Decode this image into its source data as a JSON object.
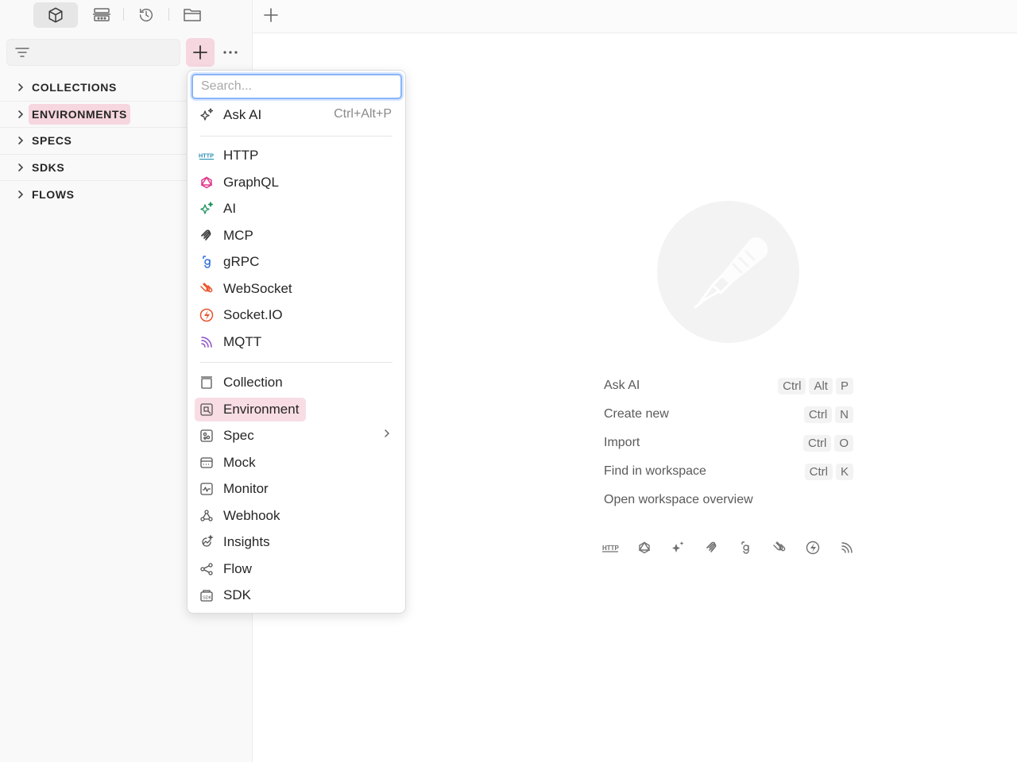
{
  "sidebar": {
    "icon_tabs": [
      "collections-cube-icon",
      "environments-icon",
      "history-icon",
      "folder-icon"
    ],
    "filter_icon": "filter-icon",
    "tree": [
      {
        "label": "COLLECTIONS",
        "highlighted": false
      },
      {
        "label": "ENVIRONMENTS",
        "highlighted": true
      },
      {
        "label": "SPECS",
        "highlighted": false
      },
      {
        "label": "SDKS",
        "highlighted": false
      },
      {
        "label": "FLOWS",
        "highlighted": false
      }
    ]
  },
  "menu": {
    "search_placeholder": "Search...",
    "ask_ai": {
      "label": "Ask AI",
      "shortcut": "Ctrl+Alt+P"
    },
    "protocols": [
      {
        "label": "HTTP",
        "icon": "http-icon",
        "color": "#2a8fb5"
      },
      {
        "label": "GraphQL",
        "icon": "graphql-icon",
        "color": "#e0378a"
      },
      {
        "label": "AI",
        "icon": "ai-sparkle-icon",
        "color": "#1f9361"
      },
      {
        "label": "MCP",
        "icon": "mcp-icon",
        "color": "#3a3a3a"
      },
      {
        "label": "gRPC",
        "icon": "grpc-icon",
        "color": "#2f6fd6"
      },
      {
        "label": "WebSocket",
        "icon": "websocket-icon",
        "color": "#e8532c"
      },
      {
        "label": "Socket.IO",
        "icon": "socketio-icon",
        "color": "#e8532c"
      },
      {
        "label": "MQTT",
        "icon": "mqtt-icon",
        "color": "#8b4fc8"
      }
    ],
    "elements": [
      {
        "label": "Collection",
        "icon": "collection-icon"
      },
      {
        "label": "Environment",
        "icon": "environment-icon",
        "highlighted": true
      },
      {
        "label": "Spec",
        "icon": "spec-icon",
        "has_submenu": true
      },
      {
        "label": "Mock",
        "icon": "mock-icon"
      },
      {
        "label": "Monitor",
        "icon": "monitor-icon"
      },
      {
        "label": "Webhook",
        "icon": "webhook-icon"
      },
      {
        "label": "Insights",
        "icon": "insights-icon"
      },
      {
        "label": "Flow",
        "icon": "flow-icon"
      },
      {
        "label": "SDK",
        "icon": "sdk-icon"
      }
    ]
  },
  "main": {
    "shortcuts": [
      {
        "label": "Ask AI",
        "keys": [
          "Ctrl",
          "Alt",
          "P"
        ]
      },
      {
        "label": "Create new",
        "keys": [
          "Ctrl",
          "N"
        ]
      },
      {
        "label": "Import",
        "keys": [
          "Ctrl",
          "O"
        ]
      },
      {
        "label": "Find in workspace",
        "keys": [
          "Ctrl",
          "K"
        ]
      },
      {
        "label": "Open workspace overview",
        "keys": []
      }
    ],
    "protocol_icons": [
      "http-icon",
      "graphql-icon",
      "ai-sparkle-icon",
      "mcp-icon",
      "grpc-icon",
      "websocket-icon",
      "socketio-icon",
      "mqtt-icon"
    ]
  },
  "colors": {
    "accent_pink": "#f6d6df",
    "focus_blue": "#8ab4f8"
  }
}
